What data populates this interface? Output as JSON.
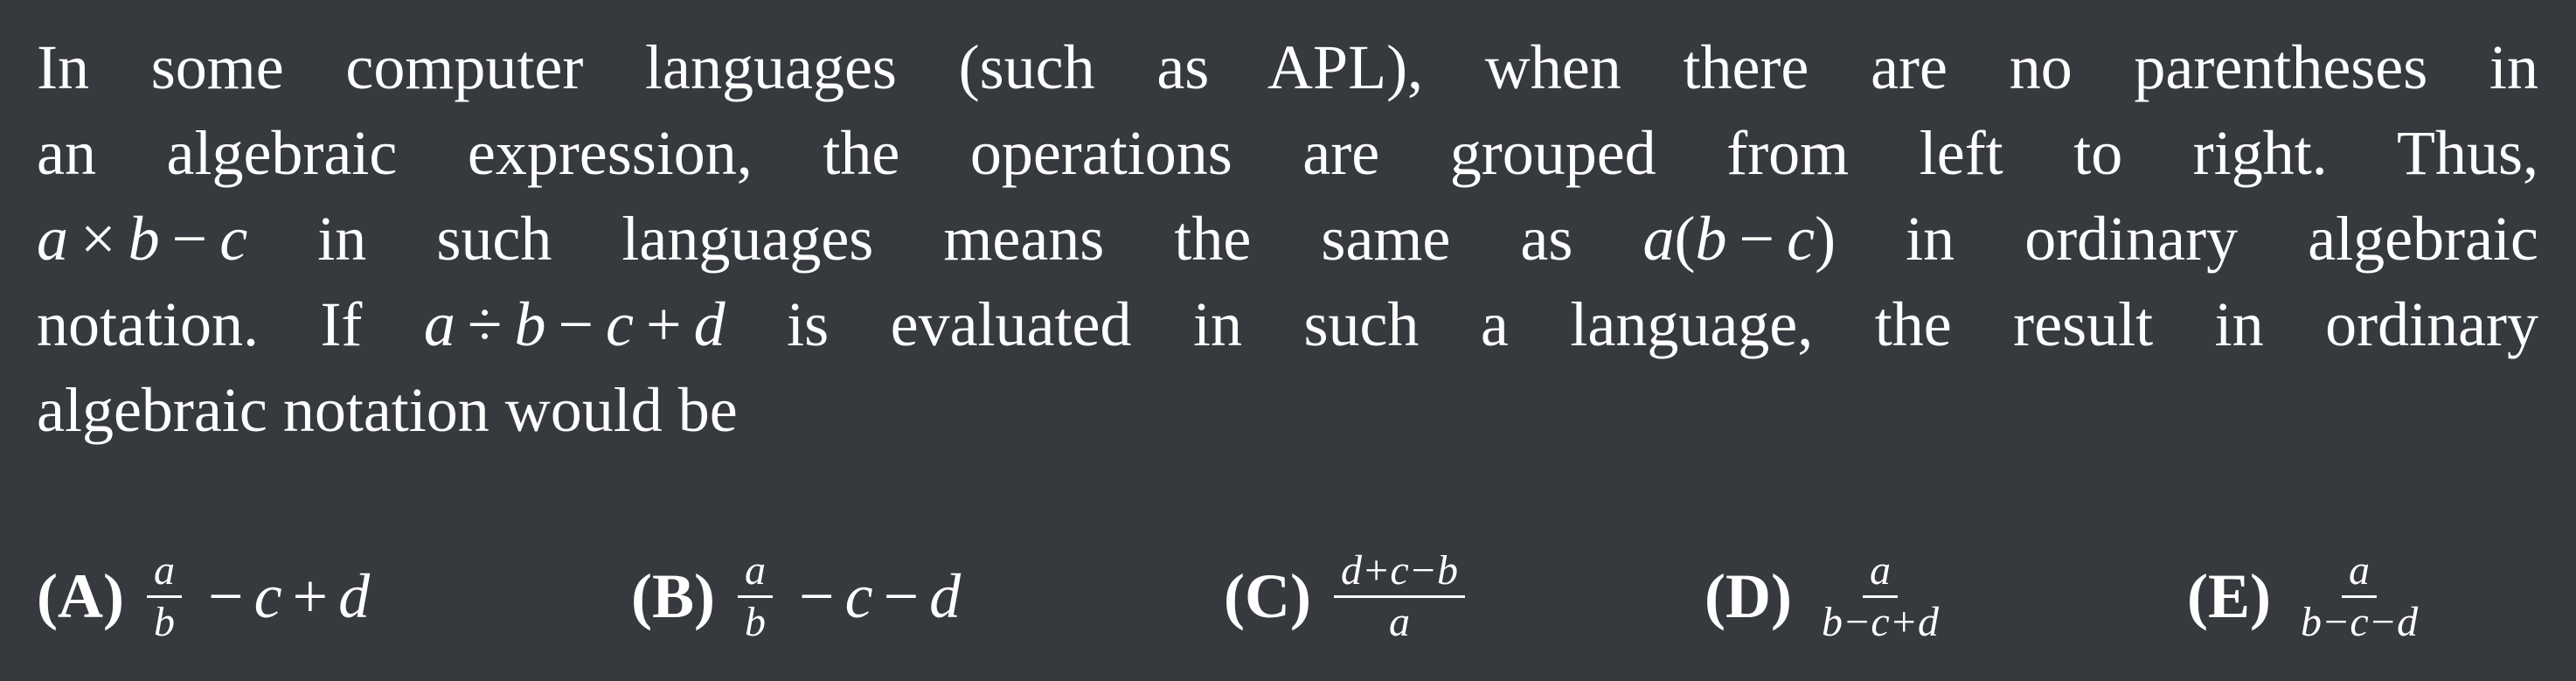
{
  "problem": {
    "line1": "In some computer languages (such as APL), when there are no parentheses in",
    "line2": "an algebraic expression, the operations are grouped from left to right.  Thus,",
    "line3": {
      "expr": {
        "a": "a",
        "times": "×",
        "b": "b",
        "minus": "−",
        "c": "c"
      },
      "text1": "in such languages means the same as",
      "expr2": {
        "a": "a",
        "open": "(",
        "b": "b",
        "minus": "−",
        "c": "c",
        "close": ")"
      },
      "text2": "in ordinary algebraic"
    },
    "line4": {
      "text1": "notation. If",
      "expr": {
        "a": "a",
        "div": "÷",
        "b": "b",
        "minus": "−",
        "c": "c",
        "plus": "+",
        "d": "d"
      },
      "text2": "is evaluated in such a language, the result in ordinary"
    },
    "line5": "algebraic notation would be"
  },
  "choices": [
    {
      "label": "(A)",
      "num": "a",
      "den": "b",
      "tail": [
        "−",
        "c",
        "+",
        "d"
      ]
    },
    {
      "label": "(B)",
      "num": "a",
      "den": "b",
      "tail": [
        "−",
        "c",
        "−",
        "d"
      ]
    },
    {
      "label": "(C)",
      "num": "d+c−b",
      "den": "a"
    },
    {
      "label": "(D)",
      "num": "a",
      "den": "b−c+d"
    },
    {
      "label": "(E)",
      "num": "a",
      "den": "b−c−d"
    }
  ]
}
